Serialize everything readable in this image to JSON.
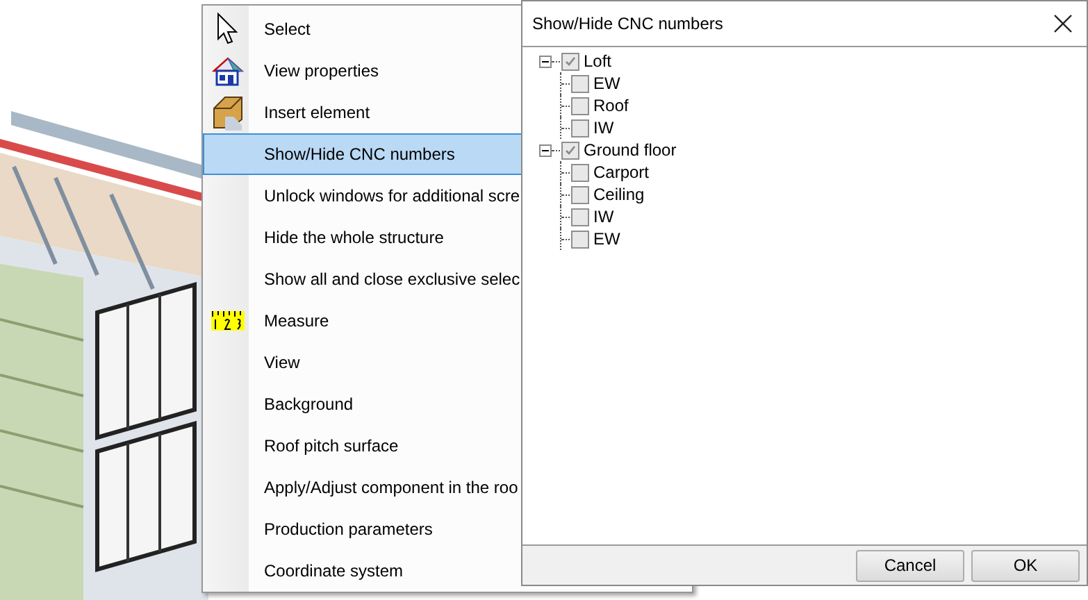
{
  "menu": {
    "items": [
      {
        "label": "Select",
        "kind": "cursor",
        "selected": false
      },
      {
        "label": "View properties",
        "kind": "house",
        "selected": false
      },
      {
        "label": "Insert element",
        "kind": "block",
        "selected": false
      },
      {
        "label": "Show/Hide CNC numbers",
        "kind": "plain",
        "selected": true
      },
      {
        "label": "Unlock windows for additional scre",
        "kind": "plain",
        "selected": false
      },
      {
        "label": "Hide the whole structure",
        "kind": "plain",
        "selected": false
      },
      {
        "label": "Show all and close exclusive selec",
        "kind": "plain",
        "selected": false
      },
      {
        "label": "Measure",
        "kind": "ruler",
        "selected": false
      },
      {
        "label": "View",
        "kind": "plain",
        "selected": false
      },
      {
        "label": "Background",
        "kind": "plain",
        "selected": false
      },
      {
        "label": "Roof pitch surface",
        "kind": "plain",
        "selected": false
      },
      {
        "label": "Apply/Adjust component in the roo",
        "kind": "plain",
        "selected": false
      },
      {
        "label": "Production parameters",
        "kind": "plain",
        "selected": false
      },
      {
        "label": "Coordinate system",
        "kind": "plain",
        "selected": false
      }
    ]
  },
  "dialog": {
    "title": "Show/Hide CNC numbers",
    "tree": [
      {
        "label": "Loft",
        "checked": true,
        "expanded": true,
        "children": [
          {
            "label": "EW",
            "checked": false
          },
          {
            "label": "Roof",
            "checked": false
          },
          {
            "label": "IW",
            "checked": false
          }
        ]
      },
      {
        "label": "Ground floor",
        "checked": true,
        "expanded": true,
        "children": [
          {
            "label": "Carport",
            "checked": false
          },
          {
            "label": "Ceiling",
            "checked": false
          },
          {
            "label": "IW",
            "checked": false
          },
          {
            "label": "EW",
            "checked": false
          }
        ]
      }
    ],
    "buttons": [
      "Cancel",
      "OK"
    ]
  }
}
